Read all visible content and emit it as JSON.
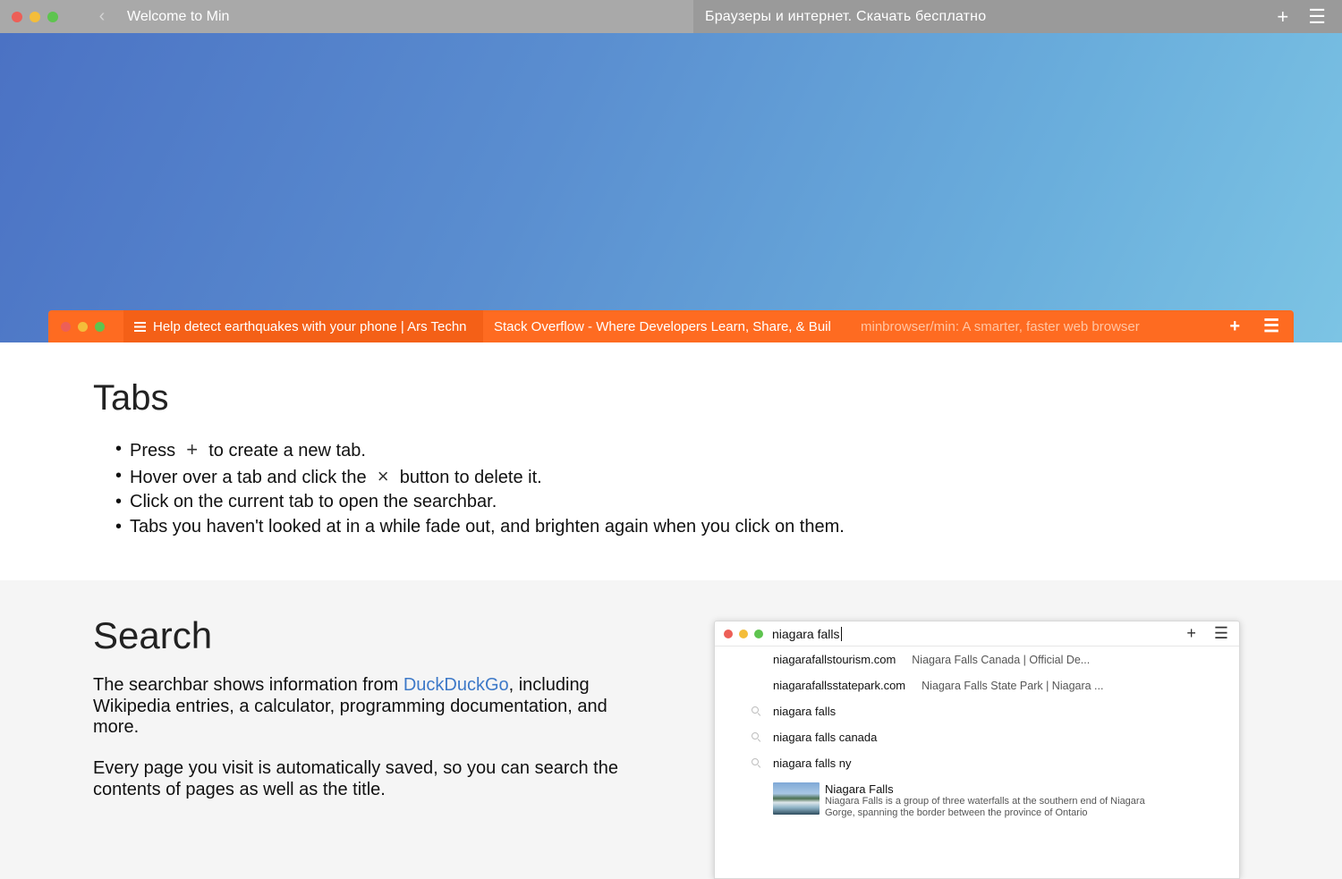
{
  "window": {
    "tab_active": "Welcome to Min",
    "tab_other": "Браузеры и интернет. Скачать бесплатно",
    "back_glyph": "‹",
    "new_tab_glyph": "+",
    "menu_glyph": "☰"
  },
  "demo_tabbar": {
    "tabs": [
      {
        "label": "Help detect earthquakes with your phone | Ars Techn"
      },
      {
        "label": "Stack Overflow - Where Developers Learn, Share, & Buil"
      },
      {
        "label": "minbrowser/min: A smarter, faster web browser"
      }
    ],
    "new_tab_glyph": "+",
    "menu_glyph": "☰",
    "accent_color": "#fe6b21"
  },
  "tabs_section": {
    "heading": "Tabs",
    "items": [
      {
        "before": "Press",
        "icon": "+",
        "after": "to create a new tab."
      },
      {
        "before": "Hover over a tab and click the",
        "icon": "×",
        "after": "button to delete it."
      },
      {
        "text": "Click on the current tab to open the searchbar."
      },
      {
        "text": "Tabs you haven't looked at in a while fade out, and brighten again when you click on them."
      }
    ]
  },
  "search_section": {
    "heading": "Search",
    "para1_before": "The searchbar shows information from ",
    "para1_link": "DuckDuckGo",
    "para1_after": ", including Wikipedia entries, a calculator, programming documentation, and more.",
    "para2": "Every page you visit is automatically saved, so you can search the contents of pages as well as the title.",
    "link_color": "#3d79c8"
  },
  "mini_browser": {
    "query": "niagara falls",
    "new_tab_glyph": "+",
    "menu_glyph": "☰",
    "results": [
      {
        "url": "niagarafallstourism.com",
        "desc": "Niagara Falls Canada | Official De..."
      },
      {
        "url": "niagarafallsstatepark.com",
        "desc": "Niagara Falls State Park | Niagara ..."
      }
    ],
    "suggestions": [
      "niagara falls",
      "niagara falls canada",
      "niagara falls ny"
    ],
    "wiki": {
      "title": "Niagara Falls",
      "desc": "Niagara Falls is a group of three waterfalls at the southern end of Niagara Gorge, spanning the border between the province of Ontario"
    }
  }
}
